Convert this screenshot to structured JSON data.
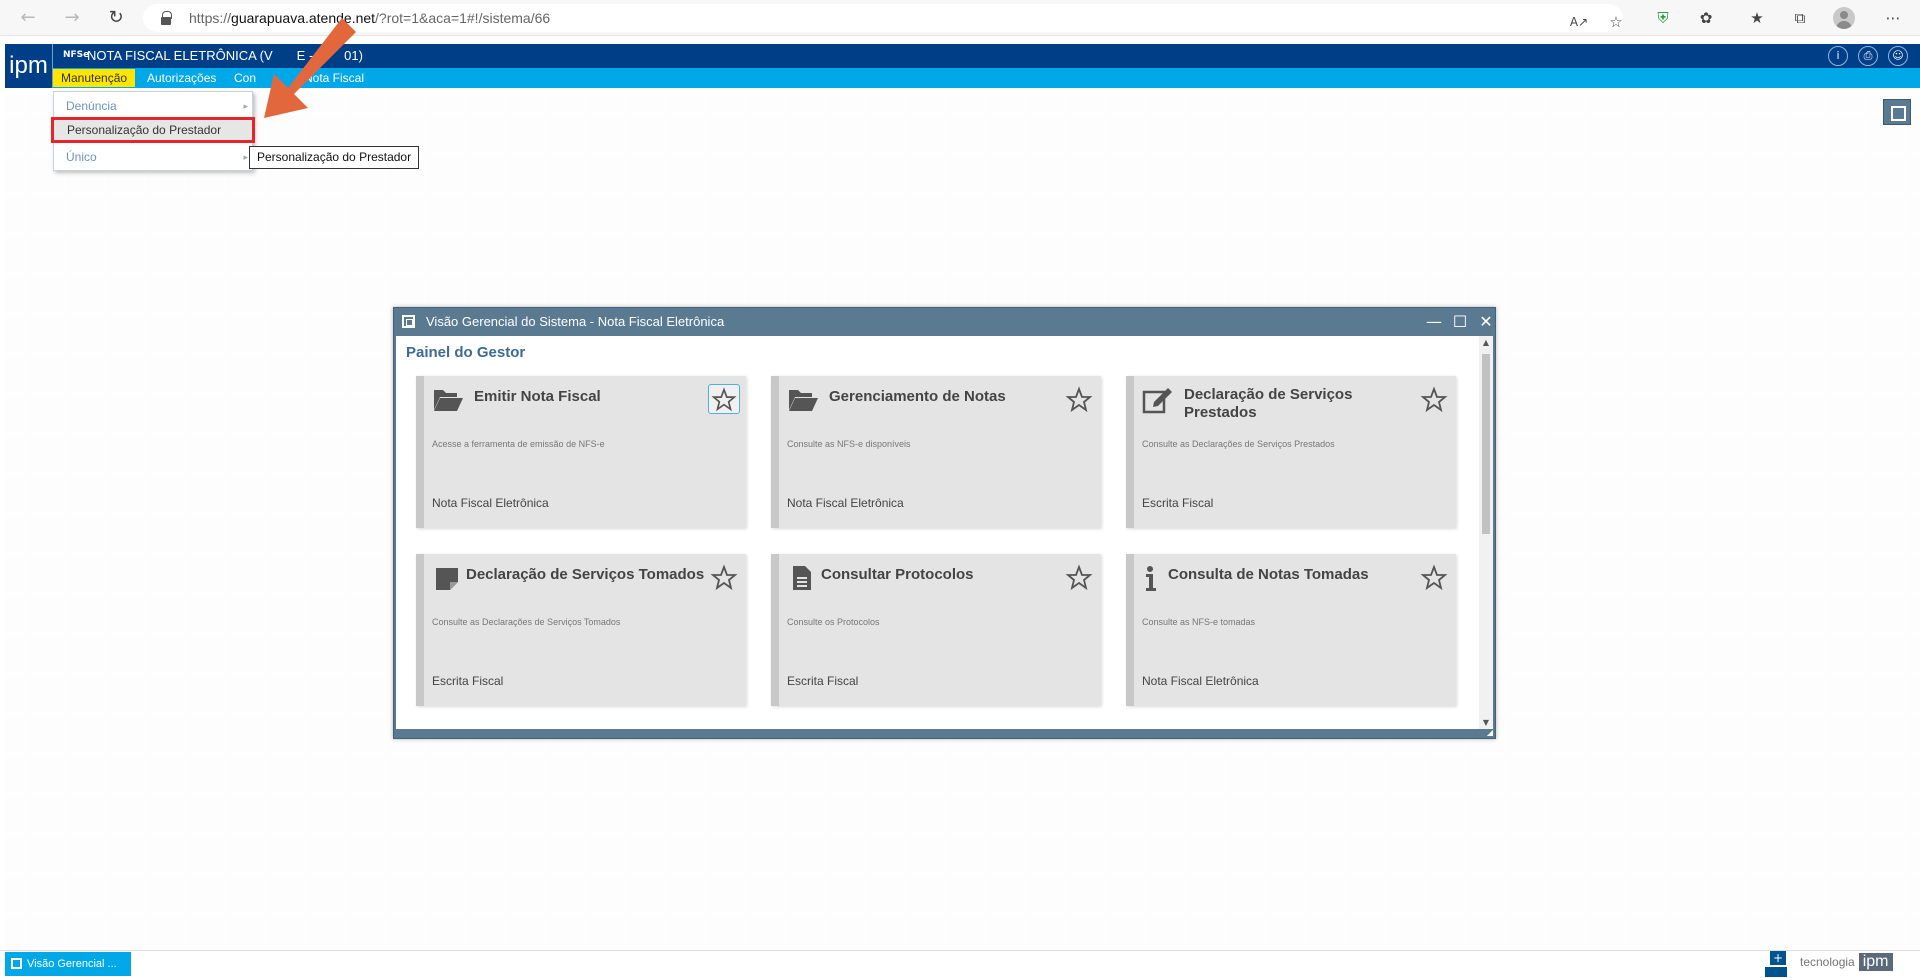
{
  "browser": {
    "url_prefix": "https://",
    "url_host": "guarapuava.atende.net",
    "url_path": "/?rot=1&aca=1#!/sistema/66"
  },
  "app": {
    "logo_text": "ipm",
    "mini_logo": "NFSe",
    "title": "NOTA FISCAL ELETRÔNICA (V",
    "title_tail": "E - 2",
    "title_end": "01)",
    "menu": [
      "Manutenção",
      "Autorizações",
      "Con",
      "Nota Fiscal"
    ]
  },
  "dropdown": {
    "items": [
      {
        "label": "Denúncia",
        "has_submenu": true
      },
      {
        "label": "Personalização do Prestador",
        "has_submenu": false
      },
      {
        "label": "Único",
        "has_submenu": true
      }
    ],
    "tooltip": "Personalização do Prestador"
  },
  "window": {
    "title": "Visão Gerencial do Sistema - Nota Fiscal Eletrônica",
    "panel_title": "Painel do Gestor",
    "cards": [
      {
        "title": "Emitir Nota Fiscal",
        "desc": "Acesse a ferramenta de emissão de NFS-e",
        "footer": "Nota Fiscal Eletrônica",
        "icon": "folder-open-icon"
      },
      {
        "title": "Gerenciamento de Notas",
        "desc": "Consulte as NFS-e disponíveis",
        "footer": "Nota Fiscal Eletrônica",
        "icon": "folder-open-icon"
      },
      {
        "title": "Declaração de Serviços Prestados",
        "desc": "Consulte as Declarações de Serviços Prestados",
        "footer": "Escrita Fiscal",
        "icon": "edit-icon"
      },
      {
        "title": "Declaração de Serviços Tomados",
        "desc": "Consulte as Declarações de Serviços Tomados",
        "footer": "Escrita Fiscal",
        "icon": "sticky-note-icon"
      },
      {
        "title": "Consultar Protocolos",
        "desc": "Consulte os Protocolos",
        "footer": "Escrita Fiscal",
        "icon": "file-text-icon"
      },
      {
        "title": "Consulta de Notas Tomadas",
        "desc": "Consulte as NFS-e tomadas",
        "footer": "Nota Fiscal Eletrônica",
        "icon": "info-icon"
      }
    ]
  },
  "taskbar": {
    "task_label": "Visão Gerencial ...",
    "brand_text": "tecnologia",
    "brand_logo": "ipm"
  },
  "colors": {
    "header_blue": "#003f87",
    "menubar_cyan": "#00a8e8",
    "active_menu_yellow": "#ffe600",
    "highlight_red": "#e8232a",
    "arrow_orange": "#e2673c",
    "window_slate": "#5a7a92"
  }
}
